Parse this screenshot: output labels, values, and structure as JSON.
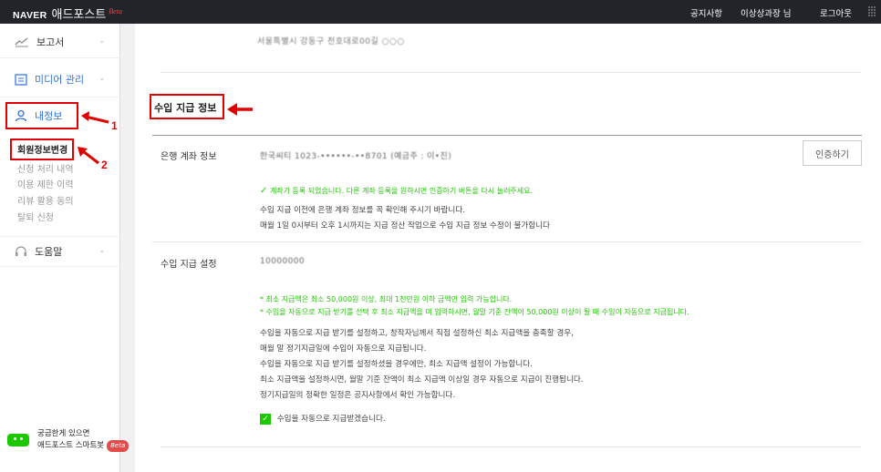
{
  "header": {
    "brand": "NAVER",
    "product": "애드포스트",
    "beta": "Beta",
    "nav": [
      "공지사항",
      "이상상과장 님",
      "로그아웃"
    ]
  },
  "sidebar": {
    "report": "보고서",
    "media": "미디어 관리",
    "myinfo": "내정보",
    "sub_items": [
      "회원정보변경",
      "신청 처리 내역",
      "이용 제한 이력",
      "리뷰 활용 동의",
      "탈퇴 신청"
    ],
    "help": "도움말",
    "chatbot_line1": "궁금한게 있으면",
    "chatbot_line2": "애드포스트 스마트봇",
    "chatbot_beta": "Beta"
  },
  "main": {
    "address_blurred": "서울특별시 강동구 천호대로00길 ○○○",
    "section_title": "수입 지급 정보",
    "bank_label": "은행 계좌 정보",
    "bank_value_blurred": "한국씨티 1023-••••••-••8701 (예금주 : 이•진)",
    "auth_button": "인증하기",
    "bank_confirm": "계좌가 등록 되었습니다. 다른 계좌 등록을 원하시면 인증하기 버튼을 다시 눌러주세요.",
    "bank_notes": [
      "수입 지급 이전에 은행 계좌 정보를 꼭 확인해 주시기 바랍니다.",
      "매월 1일 0시부터 오후 1시까지는 지급 정산 작업으로 수입 지급 정보 수정이 불가합니다"
    ],
    "payout_label": "수입 지급 설정",
    "payout_value_blurred": "10000000",
    "green_notes": [
      "* 최소 지급액은 최소 50,000원 이상, 최대 1천만원 이하 금액만 입력 가능합니다.",
      "* 수입을 자동으로 지급 받기를 선택 후 최소 지급액을 미 입력하시면, 월말 기준 잔액이 50,000원 이상이 될 때 수입이 자동으로 지급됩니다."
    ],
    "payout_notes": [
      "수입을 자동으로 지급 받기를 설정하고, 창작자님께서 직접 설정하신 최소 지급액을 충족할 경우,",
      "매월 말 정기지급일에 수입이 자동으로 지급됩니다.",
      "수입을 자동으로 지급 받기를 설정하셨을 경우에만, 최소 지급액 설정이 가능합니다.",
      "최소 지급액을 설정하시면, 월말 기준 잔액이 최소 지급액 이상일 경우 자동으로 지급이 진행됩니다.",
      "정기지급일의 정확한 일정은 공지사항에서 확인 가능합니다."
    ],
    "auto_payout_checkbox": "수입을 자동으로 지급받겠습니다."
  },
  "annotations": {
    "label_1": "1",
    "label_2": "2",
    "color": "#e00000"
  },
  "colors": {
    "accent_green": "#1ec800",
    "topbar": "#212429"
  }
}
